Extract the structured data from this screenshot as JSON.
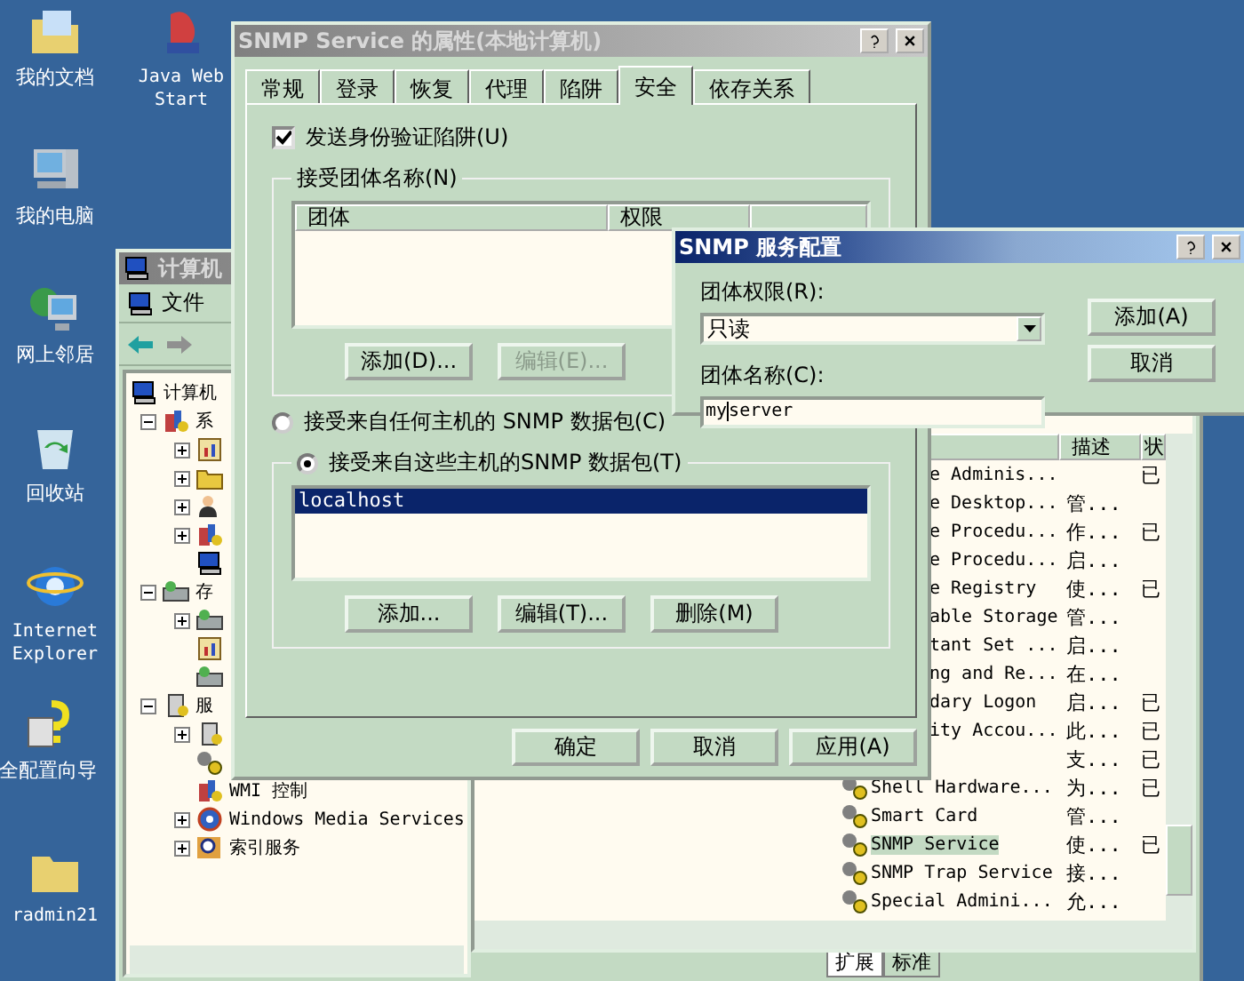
{
  "desktop_icons": [
    {
      "label": "我的文档",
      "kind": "documents"
    },
    {
      "label": "我的电脑",
      "kind": "computer"
    },
    {
      "label": "网上邻居",
      "kind": "network"
    },
    {
      "label": "回收站",
      "kind": "recycle"
    },
    {
      "label": "Internet Explorer",
      "kind": "browser"
    },
    {
      "label": "全配置向导",
      "kind": "wizard"
    },
    {
      "label": "radmin21",
      "kind": "folder"
    },
    {
      "label": "Java Web Start",
      "kind": "java"
    }
  ],
  "computer_management": {
    "title": "计算机",
    "menu": [
      "文件"
    ],
    "tree": [
      {
        "label": "计算机",
        "kind": "computer",
        "children": [
          {
            "label": "系",
            "kind": "tools",
            "expanded": true,
            "children": [
              {
                "kind": "chart",
                "expanded": false
              },
              {
                "kind": "folder",
                "expanded": false
              },
              {
                "kind": "users",
                "expanded": false
              },
              {
                "kind": "tools",
                "expanded": false
              },
              {
                "kind": "computer"
              }
            ]
          },
          {
            "label": "存",
            "kind": "disk",
            "expanded": true,
            "children": [
              {
                "kind": "disk",
                "expanded": false
              },
              {
                "kind": "chart"
              },
              {
                "kind": "disk"
              }
            ]
          },
          {
            "label": "服",
            "kind": "server",
            "expanded": true,
            "children": [
              {
                "kind": "server",
                "expanded": false
              },
              {
                "kind": "gear"
              },
              {
                "kind": "tools",
                "label": "WMI 控制"
              },
              {
                "kind": "media",
                "label": "Windows Media Services",
                "expanded": false
              },
              {
                "kind": "search",
                "label": "索引服务",
                "expanded": false
              }
            ]
          }
        ]
      }
    ],
    "columns": [
      "描述",
      "状"
    ],
    "rows": [
      {
        "kind": "partial",
        "name": "e Adminis...",
        "description": "",
        "status": "已",
        "selected": false
      },
      {
        "kind": "partial",
        "name": "e Desktop...",
        "description": "管...",
        "status": "",
        "selected": false
      },
      {
        "kind": "partial",
        "name": "e Procedu...",
        "description": "作...",
        "status": "已",
        "selected": false
      },
      {
        "kind": "partial",
        "name": "e Procedu...",
        "description": "启...",
        "status": "",
        "selected": false
      },
      {
        "kind": "partial",
        "name": "e Registry",
        "description": "使...",
        "status": "已",
        "selected": false
      },
      {
        "kind": "partial",
        "name": "able Storage",
        "description": "管...",
        "status": "",
        "selected": false
      },
      {
        "kind": "partial",
        "name": "tant Set ...",
        "description": "启...",
        "status": "",
        "selected": false
      },
      {
        "kind": "partial",
        "name": "ng and Re...",
        "description": "在...",
        "status": "",
        "selected": false
      },
      {
        "kind": "partial",
        "name": "dary Logon",
        "description": "启...",
        "status": "已",
        "selected": false
      },
      {
        "kind": "partial",
        "name": "ity Accou...",
        "description": "此...",
        "status": "已",
        "selected": false
      },
      {
        "kind": "hidden",
        "description": "支...",
        "status": "已",
        "selected": false
      },
      {
        "kind": "full",
        "name": "Shell Hardware...",
        "description": "为...",
        "status": "已",
        "selected": false
      },
      {
        "kind": "full",
        "name": "Smart Card",
        "description": "管...",
        "status": "",
        "selected": false
      },
      {
        "kind": "full",
        "name": "SNMP Service",
        "description": "使...",
        "status": "已",
        "selected": true
      },
      {
        "kind": "full",
        "name": "SNMP Trap Service",
        "description": "接...",
        "status": "",
        "selected": false
      },
      {
        "kind": "full",
        "name": "Special Admini...",
        "description": "允...",
        "status": "",
        "selected": false
      }
    ],
    "view_tabs": [
      {
        "label": "扩展",
        "selected": true
      },
      {
        "label": "标准",
        "selected": false
      }
    ]
  },
  "properties_dialog": {
    "title": "SNMP Service 的属性(本地计算机)",
    "tabs": [
      {
        "label": "常规",
        "selected": false
      },
      {
        "label": "登录",
        "selected": false
      },
      {
        "label": "恢复",
        "selected": false
      },
      {
        "label": "代理",
        "selected": false
      },
      {
        "label": "陷阱",
        "selected": false
      },
      {
        "label": "安全",
        "selected": true
      },
      {
        "label": "依存关系",
        "selected": false
      }
    ],
    "send_trap": {
      "label": "发送身份验证陷阱(U)",
      "checked": true
    },
    "communities": {
      "title": "接受团体名称(N)",
      "columns": [
        "团体",
        "权限"
      ],
      "buttons": [
        {
          "label": "添加(D)...",
          "disabled": false
        },
        {
          "label": "编辑(E)...",
          "disabled": true
        }
      ]
    },
    "hosts_options": [
      {
        "label": "接受来自任何主机的 SNMP 数据包(C)",
        "selected": false
      },
      {
        "label": "接受来自这些主机的SNMP 数据包(T)",
        "selected": true
      }
    ],
    "hosts": [
      {
        "name": "localhost",
        "selected": true
      }
    ],
    "host_buttons": [
      "添加...",
      "编辑(T)...",
      "删除(M)"
    ],
    "buttons": [
      "确定",
      "取消",
      "应用(A)"
    ]
  },
  "config_dialog": {
    "title": "SNMP 服务配置",
    "rights_label": "团体权限(R):",
    "rights_value": "只读",
    "name_label": "团体名称(C):",
    "name_value": "myserver",
    "buttons": [
      "添加(A)",
      "取消"
    ]
  }
}
